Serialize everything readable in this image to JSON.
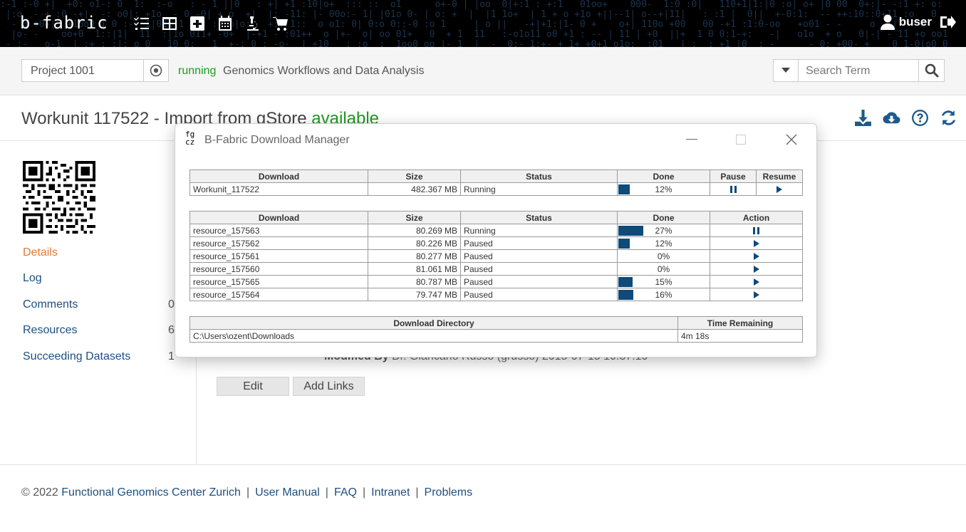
{
  "app": {
    "logo": "b-fabric"
  },
  "header": {
    "icons": [
      "tasks-icon",
      "table-icon",
      "plus-square-icon",
      "calendar-icon",
      "microscope-icon",
      "cart-icon"
    ],
    "user_name": "buser"
  },
  "project": {
    "id_value": "Project 1001",
    "status": "running",
    "name": "Genomics Workflows and Data Analysis"
  },
  "search": {
    "placeholder": "Search Term"
  },
  "page": {
    "title": "Workunit 117522 - Import from gStore",
    "status": "available"
  },
  "sidebar": {
    "items": [
      {
        "label": "Details",
        "count": ""
      },
      {
        "label": "Log",
        "count": ""
      },
      {
        "label": "Comments",
        "count": "0"
      },
      {
        "label": "Resources",
        "count": "6"
      },
      {
        "label": "Succeeding Datasets",
        "count": "1"
      }
    ]
  },
  "main": {
    "modified_label": "Modified By",
    "modified_value": "Dr. Giancarlo Russo (grusso) 2015-07-15 10:37:10",
    "edit_label": "Edit",
    "add_links_label": "Add Links"
  },
  "modal": {
    "logo_top": "fg",
    "logo_bottom": "cz",
    "title": "B-Fabric Download Manager",
    "main_table": {
      "headers": [
        "Download",
        "Size",
        "Status",
        "Done",
        "Pause",
        "Resume"
      ],
      "row": {
        "download": "Workunit_117522",
        "size": "482.367 MB",
        "status": "Running",
        "done_pct": 12,
        "done_label": "12%"
      }
    },
    "resource_table": {
      "headers": [
        "Download",
        "Size",
        "Status",
        "Done",
        "Action"
      ],
      "rows": [
        {
          "download": "resource_157563",
          "size": "80.269 MB",
          "status": "Running",
          "done_pct": 27,
          "done_label": "27%",
          "action": "pause"
        },
        {
          "download": "resource_157562",
          "size": "80.226 MB",
          "status": "Paused",
          "done_pct": 12,
          "done_label": "12%",
          "action": "play"
        },
        {
          "download": "resource_157561",
          "size": "80.277 MB",
          "status": "Paused",
          "done_pct": 0,
          "done_label": "0%",
          "action": "play"
        },
        {
          "download": "resource_157560",
          "size": "81.061 MB",
          "status": "Paused",
          "done_pct": 0,
          "done_label": "0%",
          "action": "play"
        },
        {
          "download": "resource_157565",
          "size": "80.787 MB",
          "status": "Paused",
          "done_pct": 15,
          "done_label": "15%",
          "action": "play"
        },
        {
          "download": "resource_157564",
          "size": "79.747 MB",
          "status": "Paused",
          "done_pct": 16,
          "done_label": "16%",
          "action": "play"
        }
      ]
    },
    "dir_table": {
      "headers": [
        "Download Directory",
        "Time Remaining"
      ],
      "directory": "C:\\Users\\ozent\\Downloads",
      "time_remaining": "4m 18s"
    }
  },
  "footer": {
    "copyright": "© 2022",
    "links": [
      "Functional Genomics Center Zurich",
      "User Manual",
      "FAQ",
      "Intranet",
      "Problems"
    ],
    "separator": "|"
  },
  "colors": {
    "accent": "#1d4f80",
    "active": "#e07b35",
    "status_green": "#1e9b1e",
    "bar": "#0e4a7a"
  }
}
